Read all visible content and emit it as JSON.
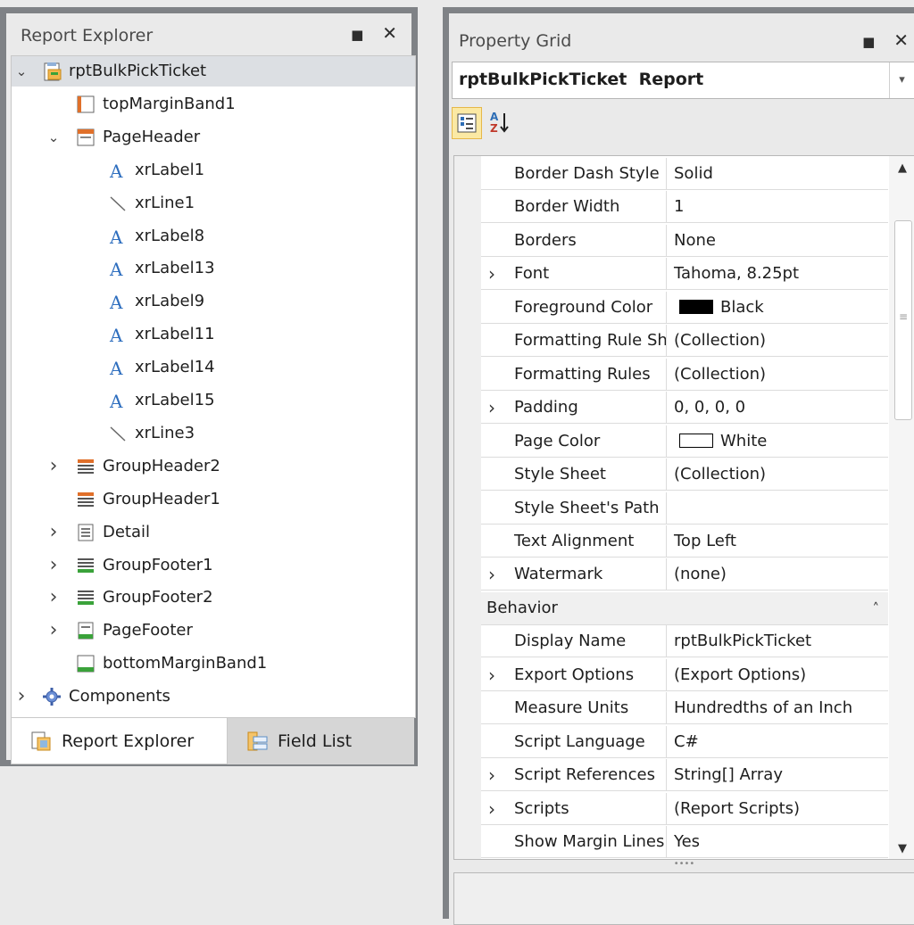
{
  "explorer": {
    "title": "Report Explorer",
    "restore_glyph": "■",
    "close_glyph": "✕",
    "tree": [
      {
        "label": "rptBulkPickTicket",
        "expander": "⌄",
        "icon": "report-icon",
        "depth": 0
      },
      {
        "label": "topMarginBand1",
        "expander": "",
        "icon": "top-margin-band-icon",
        "depth": 1
      },
      {
        "label": "PageHeader",
        "expander": "⌄",
        "icon": "page-header-icon",
        "depth": 1
      },
      {
        "label": "xrLabel1",
        "expander": "",
        "icon": "label-icon",
        "depth": 2
      },
      {
        "label": "xrLine1",
        "expander": "",
        "icon": "line-icon",
        "depth": 2
      },
      {
        "label": "xrLabel8",
        "expander": "",
        "icon": "label-icon",
        "depth": 2
      },
      {
        "label": "xrLabel13",
        "expander": "",
        "icon": "label-icon",
        "depth": 2
      },
      {
        "label": "xrLabel9",
        "expander": "",
        "icon": "label-icon",
        "depth": 2
      },
      {
        "label": "xrLabel11",
        "expander": "",
        "icon": "label-icon",
        "depth": 2
      },
      {
        "label": "xrLabel14",
        "expander": "",
        "icon": "label-icon",
        "depth": 2
      },
      {
        "label": "xrLabel15",
        "expander": "",
        "icon": "label-icon",
        "depth": 2
      },
      {
        "label": "xrLine3",
        "expander": "",
        "icon": "line-icon",
        "depth": 2
      },
      {
        "label": "GroupHeader2",
        "expander": "›",
        "icon": "group-header-icon",
        "depth": 1
      },
      {
        "label": "GroupHeader1",
        "expander": "",
        "icon": "group-header-icon",
        "depth": 1
      },
      {
        "label": "Detail",
        "expander": "›",
        "icon": "detail-band-icon",
        "depth": 1
      },
      {
        "label": "GroupFooter1",
        "expander": "›",
        "icon": "group-footer-icon",
        "depth": 1
      },
      {
        "label": "GroupFooter2",
        "expander": "›",
        "icon": "group-footer-icon",
        "depth": 1
      },
      {
        "label": "PageFooter",
        "expander": "›",
        "icon": "page-footer-icon",
        "depth": 1
      },
      {
        "label": "bottomMarginBand1",
        "expander": "",
        "icon": "bottom-margin-band-icon",
        "depth": 1
      },
      {
        "label": "Components",
        "expander": "›",
        "icon": "components-gear-icon",
        "depth": 0
      }
    ],
    "tabs": [
      {
        "label": "Report Explorer",
        "icon": "report-explorer-tab-icon",
        "active": true
      },
      {
        "label": "Field List",
        "icon": "field-list-tab-icon",
        "active": false
      }
    ]
  },
  "propgrid": {
    "title": "Property Grid",
    "restore_glyph": "■",
    "close_glyph": "✕",
    "object_name": "rptBulkPickTicket",
    "object_type": "Report",
    "dropdown_glyph": "▾",
    "sort_az_label": "A Z",
    "rows": [
      {
        "kind": "prop",
        "name": "Border Dash Style",
        "value": "Solid",
        "expand": ""
      },
      {
        "kind": "prop",
        "name": "Border Width",
        "value": "1",
        "expand": ""
      },
      {
        "kind": "prop",
        "name": "Borders",
        "value": "None",
        "expand": ""
      },
      {
        "kind": "prop",
        "name": "Font",
        "value": "Tahoma, 8.25pt",
        "expand": "›"
      },
      {
        "kind": "prop",
        "name": "Foreground Color",
        "value": "Black",
        "expand": "",
        "swatch": "#000000"
      },
      {
        "kind": "prop",
        "name": "Formatting Rule Sheet",
        "value": "(Collection)",
        "expand": ""
      },
      {
        "kind": "prop",
        "name": "Formatting Rules",
        "value": "(Collection)",
        "expand": ""
      },
      {
        "kind": "prop",
        "name": "Padding",
        "value": "0, 0, 0, 0",
        "expand": "›"
      },
      {
        "kind": "prop",
        "name": "Page Color",
        "value": "White",
        "expand": "",
        "swatch": "#ffffff"
      },
      {
        "kind": "prop",
        "name": "Style Sheet",
        "value": "(Collection)",
        "expand": ""
      },
      {
        "kind": "prop",
        "name": "Style Sheet's Path",
        "value": "",
        "expand": ""
      },
      {
        "kind": "prop",
        "name": "Text Alignment",
        "value": "Top Left",
        "expand": ""
      },
      {
        "kind": "prop",
        "name": "Watermark",
        "value": "(none)",
        "expand": "›"
      },
      {
        "kind": "category",
        "name": "Behavior",
        "collapse": "˄"
      },
      {
        "kind": "prop",
        "name": "Display Name",
        "value": "rptBulkPickTicket",
        "expand": ""
      },
      {
        "kind": "prop",
        "name": "Export Options",
        "value": "(Export Options)",
        "expand": "›"
      },
      {
        "kind": "prop",
        "name": "Measure Units",
        "value": "Hundredths of an Inch",
        "expand": ""
      },
      {
        "kind": "prop",
        "name": "Script Language",
        "value": "C#",
        "expand": ""
      },
      {
        "kind": "prop",
        "name": "Script References",
        "value": "String[] Array",
        "expand": "›"
      },
      {
        "kind": "prop",
        "name": "Scripts",
        "value": "(Report Scripts)",
        "expand": "›"
      },
      {
        "kind": "prop",
        "name": "Show Margin Lines",
        "value": "Yes",
        "expand": ""
      }
    ],
    "scroll_up": "▲",
    "scroll_down": "▼",
    "scroll_grip": "≡",
    "splitter_grip": "••••"
  }
}
